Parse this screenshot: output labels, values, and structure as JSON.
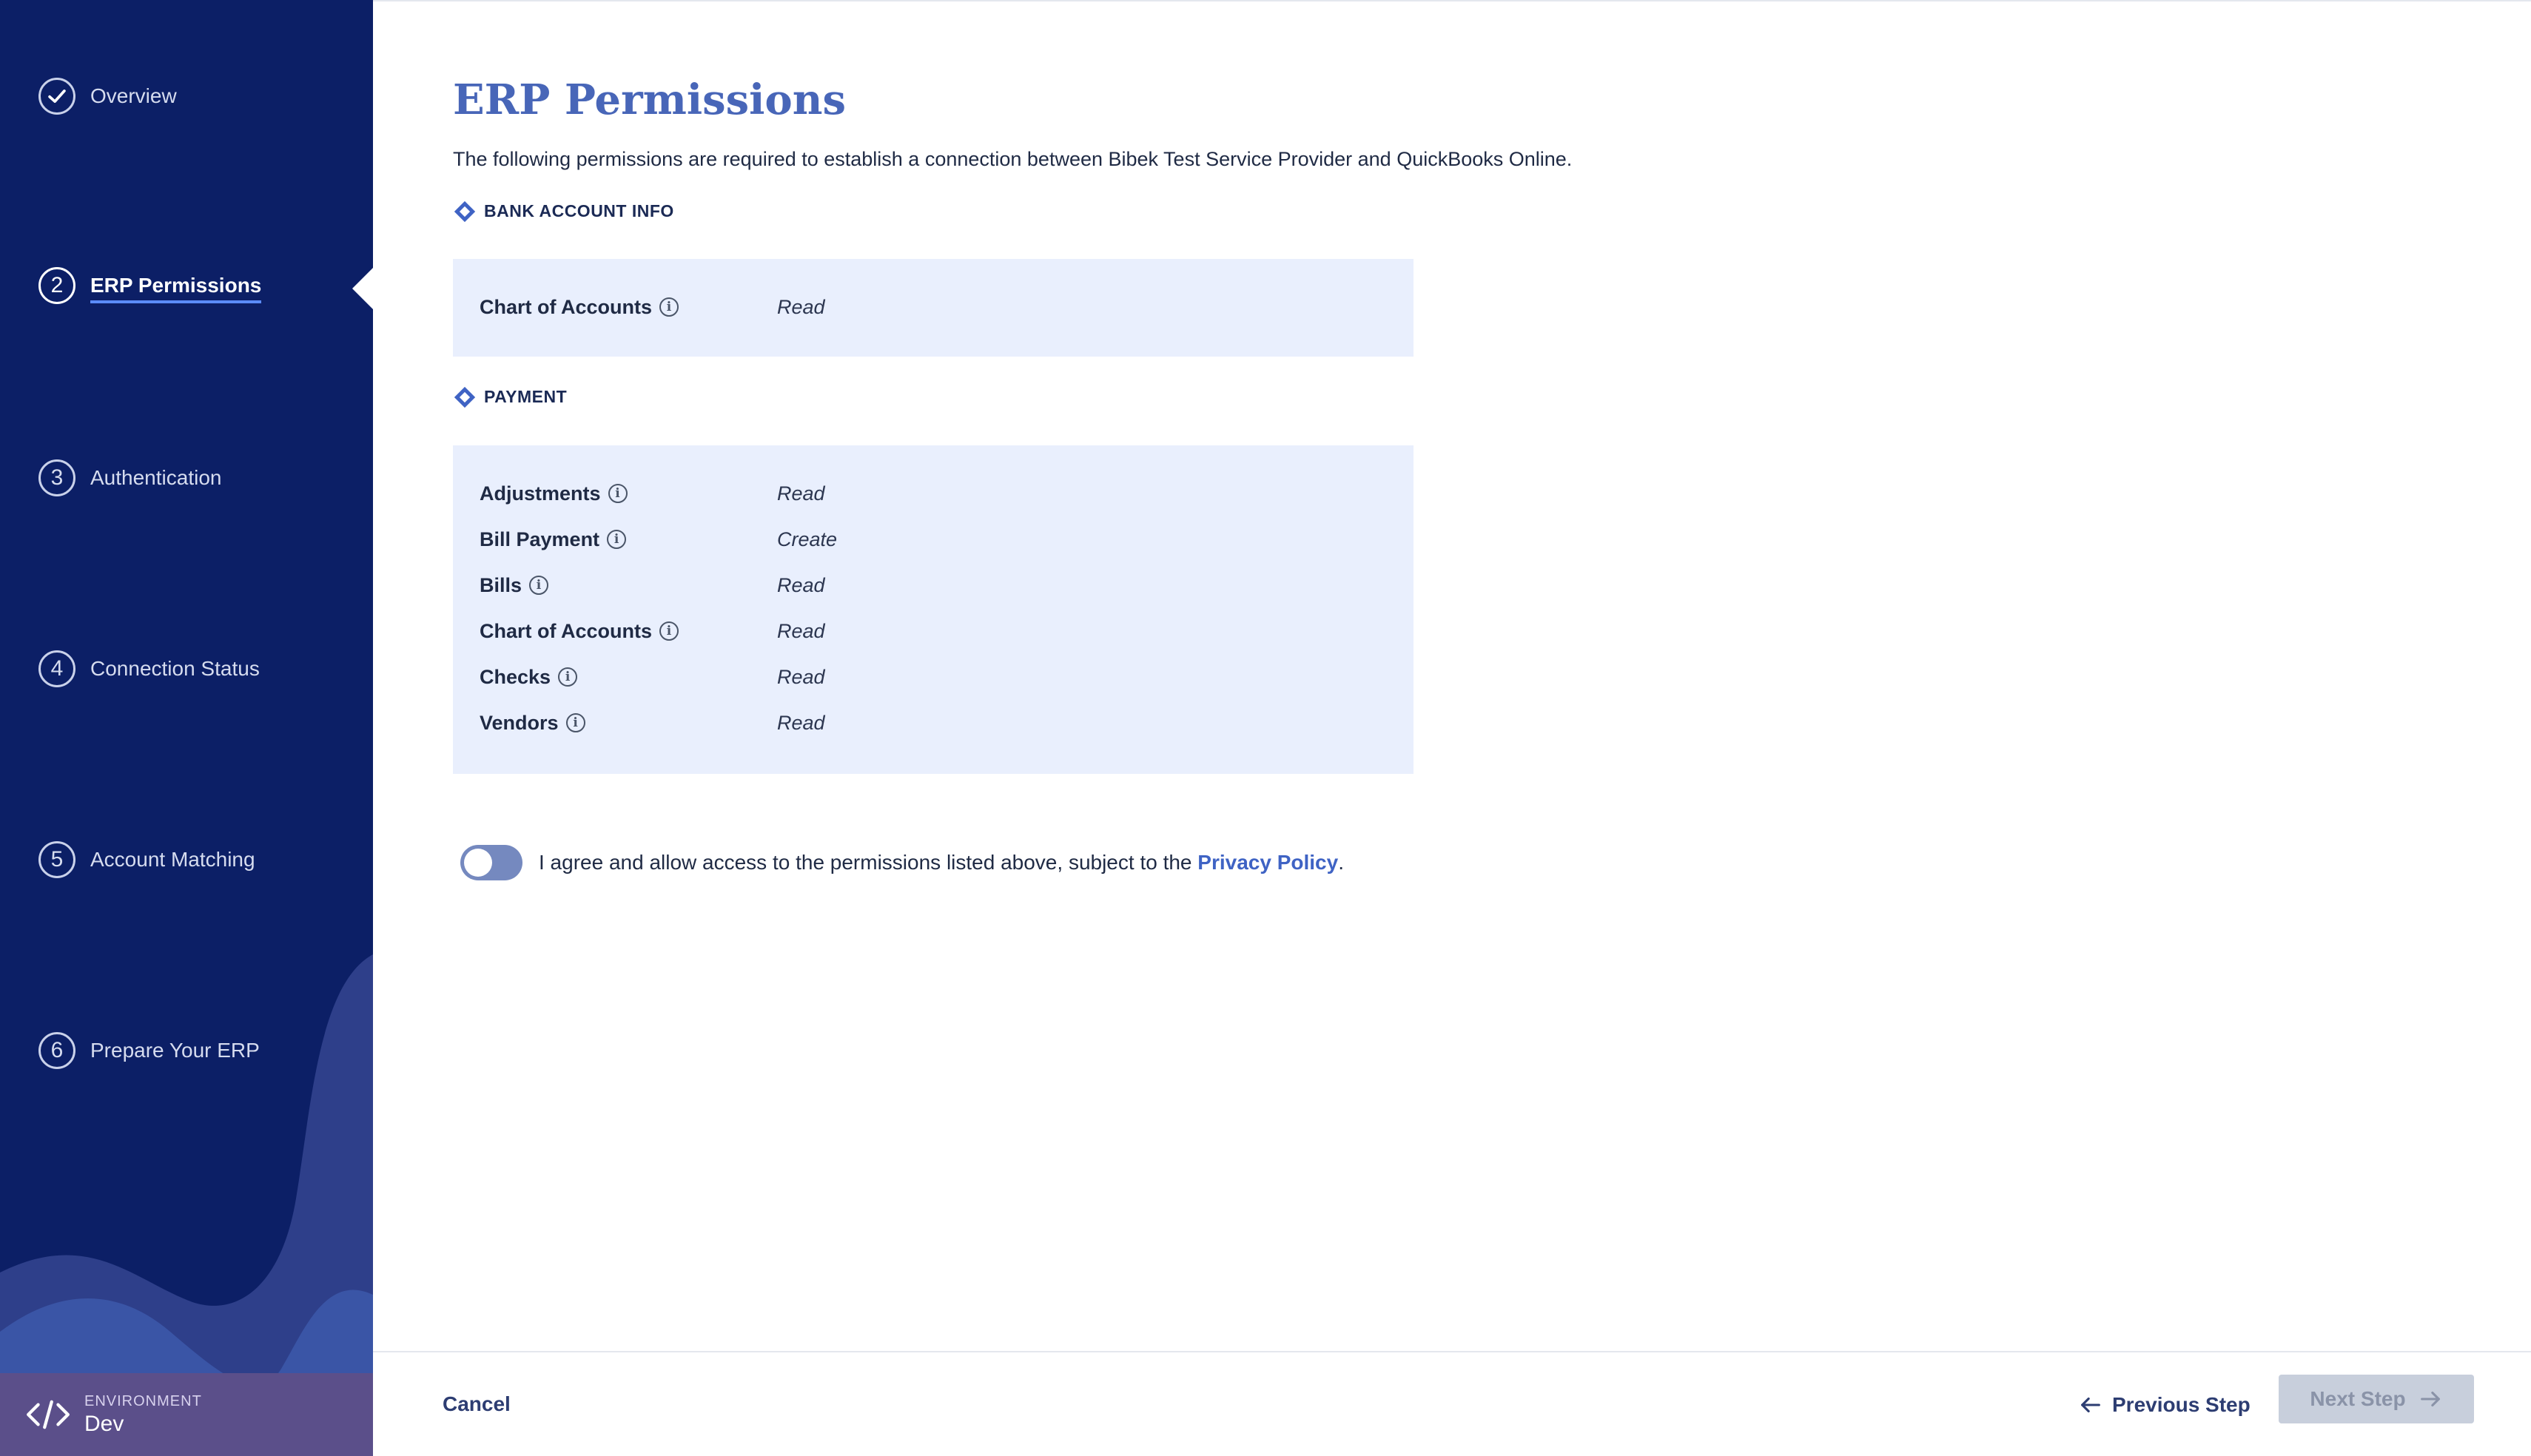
{
  "sidebar": {
    "steps": [
      {
        "number": "",
        "label": "Overview",
        "state": "completed",
        "icon": "check-icon"
      },
      {
        "number": "2",
        "label": "ERP Permissions",
        "state": "active"
      },
      {
        "number": "3",
        "label": "Authentication",
        "state": "pending"
      },
      {
        "number": "4",
        "label": "Connection Status",
        "state": "pending"
      },
      {
        "number": "5",
        "label": "Account Matching",
        "state": "pending"
      },
      {
        "number": "6",
        "label": "Prepare Your ERP",
        "state": "pending"
      }
    ],
    "environment": {
      "label": "ENVIRONMENT",
      "value": "Dev",
      "icon": "code-icon"
    }
  },
  "main": {
    "title": "ERP Permissions",
    "description": "The following permissions are required to establish a connection between Bibek Test Service Provider and QuickBooks Online.",
    "sections": [
      {
        "header": "BANK ACCOUNT INFO",
        "permissions": [
          {
            "name": "Chart of Accounts",
            "access": "Read"
          }
        ]
      },
      {
        "header": "PAYMENT",
        "permissions": [
          {
            "name": "Adjustments",
            "access": "Read"
          },
          {
            "name": "Bill Payment",
            "access": "Create"
          },
          {
            "name": "Bills",
            "access": "Read"
          },
          {
            "name": "Chart of Accounts",
            "access": "Read"
          },
          {
            "name": "Checks",
            "access": "Read"
          },
          {
            "name": "Vendors",
            "access": "Read"
          }
        ]
      }
    ],
    "consent": {
      "text": "I agree and allow access to the permissions listed above, subject to the ",
      "link": "Privacy Policy",
      "suffix": ".",
      "toggle_on": false
    }
  },
  "footer": {
    "cancel": "Cancel",
    "previous": "Previous Step",
    "next": "Next Step",
    "next_enabled": false
  },
  "colors": {
    "sidebar_bg": "#0c1f66",
    "accent": "#4866b8",
    "permission_box_bg": "#e9effd",
    "environment_bg": "#5b4f8a"
  }
}
